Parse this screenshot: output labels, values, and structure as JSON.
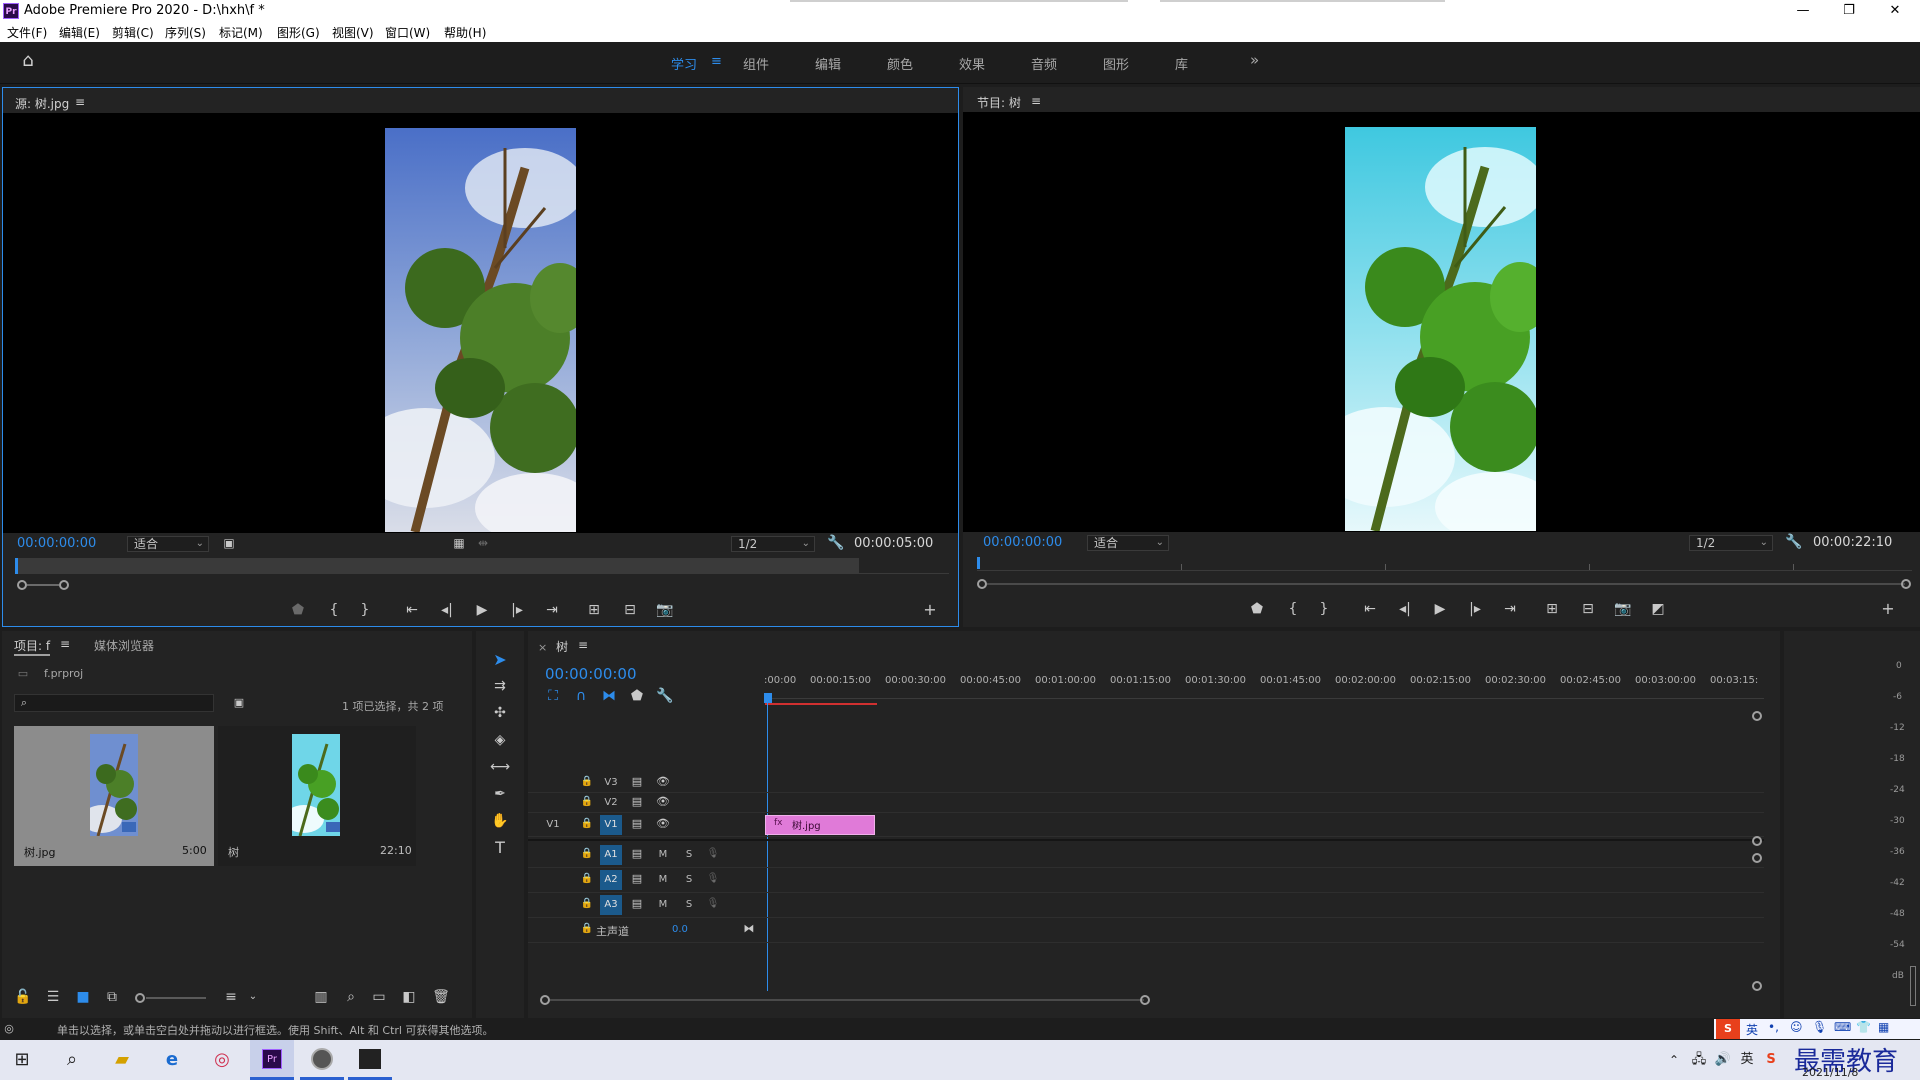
{
  "app": {
    "title": "Adobe Premiere Pro 2020 - D:\\hxh\\f *",
    "logo": "Pr"
  },
  "window_controls": {
    "minimize": "—",
    "maximize": "❐",
    "close": "✕"
  },
  "menu": [
    "文件(F)",
    "编辑(E)",
    "剪辑(C)",
    "序列(S)",
    "标记(M)",
    "图形(G)",
    "视图(V)",
    "窗口(W)",
    "帮助(H)"
  ],
  "workspaces": {
    "items": [
      "学习",
      "组件",
      "编辑",
      "颜色",
      "效果",
      "音频",
      "图形",
      "库"
    ],
    "active_index": 0,
    "more": "»"
  },
  "source_monitor": {
    "title": "源: 树.jpg",
    "menu_icon": "≡",
    "timecode": "00:00:00:00",
    "fit": "适合",
    "resolution": "1/2",
    "duration": "00:00:05:00"
  },
  "program_monitor": {
    "title": "节目: 树",
    "menu_icon": "≡",
    "timecode": "00:00:00:00",
    "fit": "适合",
    "resolution": "1/2",
    "duration": "00:00:22:10"
  },
  "project_panel": {
    "tabs": [
      "项目: f",
      "媒体浏览器"
    ],
    "menu_icon": "≡",
    "file": "f.prproj",
    "selection_info": "1 项已选择，共 2 项",
    "items": [
      {
        "name": "树.jpg",
        "duration": "5:00"
      },
      {
        "name": "树",
        "duration": "22:10"
      }
    ]
  },
  "timeline": {
    "tab": "树",
    "close": "×",
    "menu_icon": "≡",
    "timecode": "00:00:00:00",
    "ruler_labels": [
      ":00:00",
      "00:00:15:00",
      "00:00:30:00",
      "00:00:45:00",
      "00:01:00:00",
      "00:01:15:00",
      "00:01:30:00",
      "00:01:45:00",
      "00:02:00:00",
      "00:02:15:00",
      "00:02:30:00",
      "00:02:45:00",
      "00:03:00:00",
      "00:03:15:"
    ],
    "video_tracks": [
      "V3",
      "V2",
      "V1"
    ],
    "audio_tracks": [
      "A1",
      "A2",
      "A3"
    ],
    "source_patch": "V1",
    "mute": "M",
    "solo": "S",
    "master_label": "主声道",
    "master_value": "0.0",
    "clip_label": "树.jpg",
    "clip_icon": "fx"
  },
  "audio_meter": {
    "labels": [
      "0",
      "-6",
      "-12",
      "-18",
      "-24",
      "-30",
      "-36",
      "-42",
      "-48",
      "-54",
      "dB"
    ]
  },
  "status": {
    "text": "单击以选择，或单击空白处并拖动以进行框选。使用 Shift、Alt 和 Ctrl 可获得其他选项。"
  },
  "tray": {
    "ime": "英",
    "date": "2021/11/8",
    "watermark": "最需教育"
  }
}
